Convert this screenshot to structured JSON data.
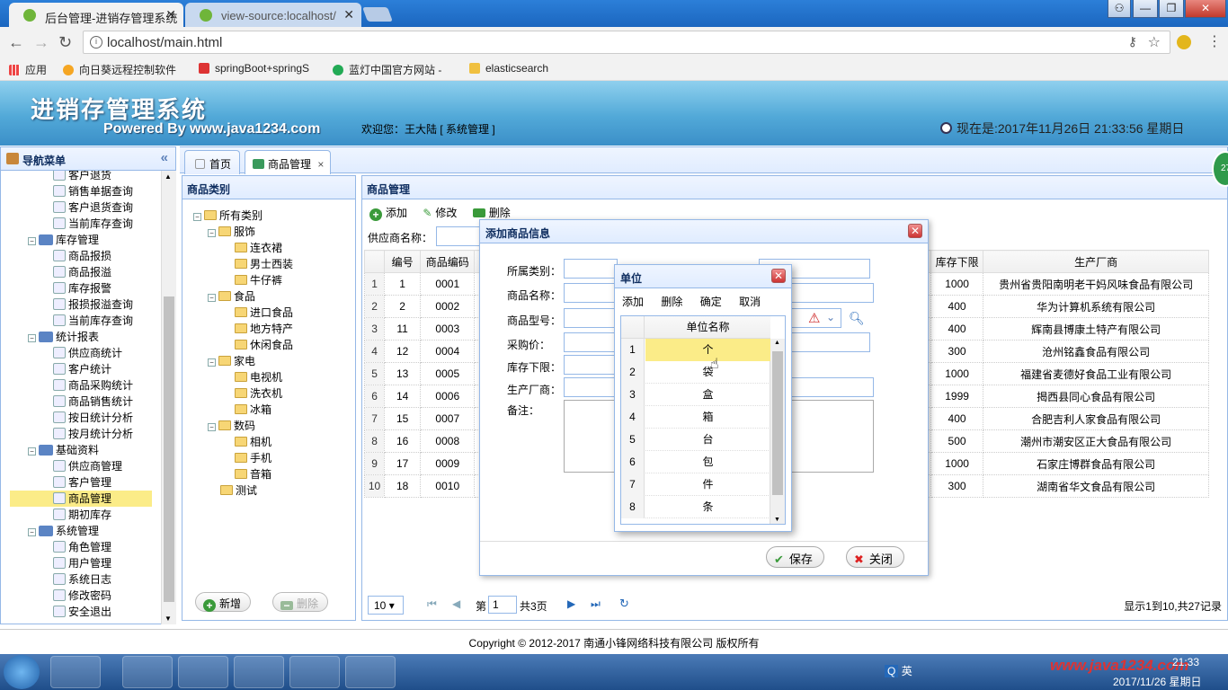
{
  "browser": {
    "tabs": [
      {
        "title": "后台管理-进销存管理系统"
      },
      {
        "title": "view-source:localhost/"
      }
    ],
    "url": "localhost/main.html",
    "bookmarks": [
      {
        "label": "应用"
      },
      {
        "label": "向日葵远程控制软件"
      },
      {
        "label": "springBoot+springS"
      },
      {
        "label": "蓝灯中国官方网站 - "
      },
      {
        "label": "elasticsearch"
      }
    ]
  },
  "header": {
    "logo": "进销存管理系统",
    "powered": "Powered By www.java1234.com",
    "welcome": "欢迎您：王大陆 [ 系统管理 ]",
    "clock": "现在是:2017年11月26日 21:33:56 星期日"
  },
  "nav": {
    "title": "导航菜单",
    "items": [
      {
        "label": "客户退货",
        "indent": 3,
        "icon": "report-icon"
      },
      {
        "label": "销售单据查询",
        "indent": 3,
        "icon": "search-doc-icon"
      },
      {
        "label": "客户退货查询",
        "indent": 3,
        "icon": "search-doc-icon"
      },
      {
        "label": "当前库存查询",
        "indent": 3,
        "icon": "search-doc-icon"
      },
      {
        "label": "库存管理",
        "indent": 2,
        "icon": "stock-icon",
        "group": true
      },
      {
        "label": "商品报损",
        "indent": 3,
        "icon": "doc-icon"
      },
      {
        "label": "商品报溢",
        "indent": 3,
        "icon": "doc-icon"
      },
      {
        "label": "库存报警",
        "indent": 3,
        "icon": "alarm-icon"
      },
      {
        "label": "报损报溢查询",
        "indent": 3,
        "icon": "search-doc-icon"
      },
      {
        "label": "当前库存查询",
        "indent": 3,
        "icon": "search-doc-icon"
      },
      {
        "label": "统计报表",
        "indent": 2,
        "icon": "chart-icon",
        "group": true
      },
      {
        "label": "供应商统计",
        "indent": 3,
        "icon": "chart-icon"
      },
      {
        "label": "客户统计",
        "indent": 3,
        "icon": "chart-icon"
      },
      {
        "label": "商品采购统计",
        "indent": 3,
        "icon": "chart-icon"
      },
      {
        "label": "商品销售统计",
        "indent": 3,
        "icon": "chart-icon"
      },
      {
        "label": "按日统计分析",
        "indent": 3,
        "icon": "chart-icon"
      },
      {
        "label": "按月统计分析",
        "indent": 3,
        "icon": "chart-icon"
      },
      {
        "label": "基础资料",
        "indent": 2,
        "icon": "base-icon",
        "group": true
      },
      {
        "label": "供应商管理",
        "indent": 3,
        "icon": "user-icon"
      },
      {
        "label": "客户管理",
        "indent": 3,
        "icon": "user-icon"
      },
      {
        "label": "商品管理",
        "indent": 3,
        "icon": "tree-icon",
        "selected": true
      },
      {
        "label": "期初库存",
        "indent": 3,
        "icon": "doc-icon"
      },
      {
        "label": "系统管理",
        "indent": 2,
        "icon": "computer-icon",
        "group": true
      },
      {
        "label": "角色管理",
        "indent": 3,
        "icon": "user-icon"
      },
      {
        "label": "用户管理",
        "indent": 3,
        "icon": "user-icon"
      },
      {
        "label": "系统日志",
        "indent": 3,
        "icon": "log-icon"
      },
      {
        "label": "修改密码",
        "indent": 3,
        "icon": "lock-icon"
      },
      {
        "label": "安全退出",
        "indent": 3,
        "icon": "exit-icon"
      }
    ]
  },
  "maintabs": [
    {
      "label": "首页"
    },
    {
      "label": "商品管理"
    }
  ],
  "category": {
    "title": "商品类别",
    "tree": [
      {
        "label": "所有类别",
        "level": 0
      },
      {
        "label": "服饰",
        "level": 1
      },
      {
        "label": "连衣裙",
        "level": 2
      },
      {
        "label": "男士西装",
        "level": 2
      },
      {
        "label": "牛仔裤",
        "level": 2
      },
      {
        "label": "食品",
        "level": 1
      },
      {
        "label": "进口食品",
        "level": 2
      },
      {
        "label": "地方特产",
        "level": 2
      },
      {
        "label": "休闲食品",
        "level": 2
      },
      {
        "label": "家电",
        "level": 1
      },
      {
        "label": "电视机",
        "level": 2
      },
      {
        "label": "洗衣机",
        "level": 2
      },
      {
        "label": "冰箱",
        "level": 2
      },
      {
        "label": "数码",
        "level": 1
      },
      {
        "label": "相机",
        "level": 2
      },
      {
        "label": "手机",
        "level": 2
      },
      {
        "label": "音箱",
        "level": 2
      },
      {
        "label": "测试",
        "level": 1
      }
    ],
    "add_btn": "新增",
    "del_btn": "删除"
  },
  "product": {
    "title": "商品管理",
    "toolbar": {
      "add": "添加",
      "edit": "修改",
      "delete": "删除"
    },
    "supplier_label": "供应商名称：",
    "columns": {
      "id": "编号",
      "code": "商品编码",
      "min": "库存下限",
      "maker": "生产厂商"
    },
    "rows": [
      {
        "rn": "1",
        "id": "1",
        "code": "0001",
        "min": "1000",
        "maker": "贵州省贵阳南明老干妈风味食品有限公司"
      },
      {
        "rn": "2",
        "id": "2",
        "code": "0002",
        "min": "400",
        "maker": "华为计算机系统有限公司"
      },
      {
        "rn": "3",
        "id": "11",
        "code": "0003",
        "min": "400",
        "maker": "辉南县博康土特产有限公司"
      },
      {
        "rn": "4",
        "id": "12",
        "code": "0004",
        "min": "300",
        "maker": "沧州铭鑫食品有限公司"
      },
      {
        "rn": "5",
        "id": "13",
        "code": "0005",
        "min": "1000",
        "maker": "福建省麦德好食品工业有限公司"
      },
      {
        "rn": "6",
        "id": "14",
        "code": "0006",
        "min": "1999",
        "maker": "揭西县同心食品有限公司"
      },
      {
        "rn": "7",
        "id": "15",
        "code": "0007",
        "min": "400",
        "maker": "合肥吉利人家食品有限公司"
      },
      {
        "rn": "8",
        "id": "16",
        "code": "0008",
        "min": "500",
        "maker": "潮州市潮安区正大食品有限公司"
      },
      {
        "rn": "9",
        "id": "17",
        "code": "0009",
        "min": "1000",
        "maker": "石家庄博群食品有限公司"
      },
      {
        "rn": "10",
        "id": "18",
        "code": "0010",
        "min": "300",
        "maker": "湖南省华文食品有限公司"
      }
    ],
    "pager": {
      "size": "10",
      "page_prefix": "第",
      "page": "1",
      "page_suffix": "共3页",
      "summary": "显示1到10,共27记录"
    }
  },
  "addDialog": {
    "title": "添加商品信息",
    "labels": {
      "category": "所属类别：",
      "name": "商品名称：",
      "model": "商品型号：",
      "price": "采购价：",
      "min": "库存下限：",
      "maker": "生产厂商：",
      "remark": "备注："
    },
    "save": "保存",
    "close": "关闭"
  },
  "unitDialog": {
    "title": "单位",
    "toolbar": {
      "add": "添加",
      "delete": "删除",
      "confirm": "确定",
      "cancel": "取消"
    },
    "column": "单位名称",
    "rows": [
      {
        "n": "1",
        "name": "个"
      },
      {
        "n": "2",
        "name": "袋"
      },
      {
        "n": "3",
        "name": "盒"
      },
      {
        "n": "4",
        "name": "箱"
      },
      {
        "n": "5",
        "name": "台"
      },
      {
        "n": "6",
        "name": "包"
      },
      {
        "n": "7",
        "name": "件"
      },
      {
        "n": "8",
        "name": "条"
      }
    ]
  },
  "footer": "Copyright © 2012-2017 南通小锋网络科技有限公司 版权所有",
  "taskbar": {
    "ime": "英",
    "time": "21:33",
    "date": "2017/11/26 星期日",
    "watermark": "www.java1234.com",
    "badge": "27"
  }
}
